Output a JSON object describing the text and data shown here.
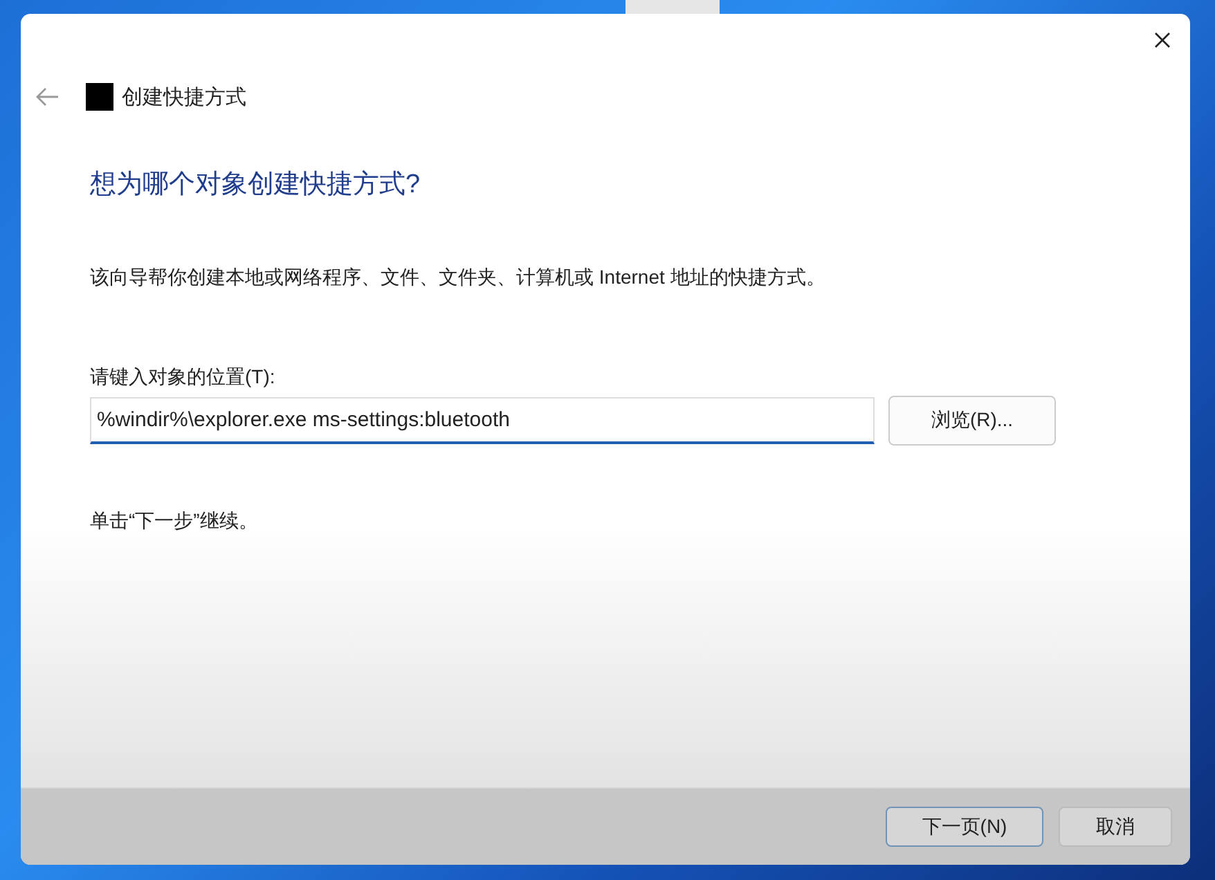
{
  "window": {
    "title": "创建快捷方式"
  },
  "heading": "想为哪个对象创建快捷方式?",
  "description": "该向导帮你创建本地或网络程序、文件、文件夹、计算机或 Internet 地址的快捷方式。",
  "location": {
    "label": "请键入对象的位置(T):",
    "value": "%windir%\\explorer.exe ms-settings:bluetooth",
    "browse_button": "浏览(R)..."
  },
  "hint": "单击“下一步”继续。",
  "buttons": [
    {
      "label": "下一页(N)",
      "default": true
    },
    {
      "label": "取消",
      "default": false
    }
  ]
}
